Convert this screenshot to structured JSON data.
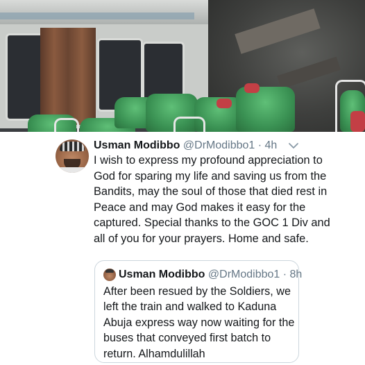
{
  "tweet": {
    "author_name": "Usman Modibbo",
    "author_handle": "@DrModibbo1",
    "separator": "·",
    "time": "4h",
    "text": "I wish to express my profound appreciation to God for sparing my life and saving us from the Bandits, may the  soul of those that died rest in Peace and may God makes it easy for the captured. Special thanks to the GOC 1 Div and all of you for your prayers. Home and safe.",
    "menu_icon": "chevron-down-icon"
  },
  "quoted_tweet": {
    "author_name": "Usman Modibbo",
    "author_handle": "@DrModibbo1",
    "separator": "·",
    "time": "8h",
    "text": "After been resued by the Soldiers, we left the train and walked to Kaduna Abuja express way now  waiting for the buses that conveyed first batch to return. Alhamdulillah"
  },
  "colors": {
    "text": "#14171a",
    "secondary": "#657786",
    "border": "#ccd6dd"
  }
}
